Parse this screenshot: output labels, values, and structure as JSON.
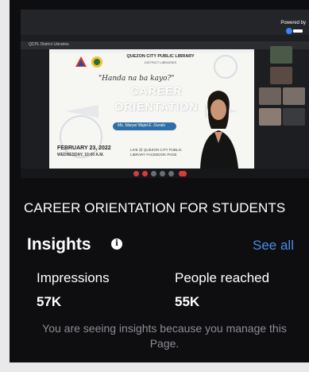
{
  "meeting": {
    "powered_by": "Powered by",
    "bar_text": "QCPL District Libraries",
    "slide": {
      "library_name": "QUEZON CITY PUBLIC LIBRARY",
      "library_sub": "DISTRICT LIBRARIES",
      "tagline": "\"Handa na ba kayo?\"",
      "headline_1": "CAREER",
      "headline_2": "ORIENTATION",
      "speaker_pill": "Ms. Maryel Mejid E. Duralo",
      "date": "FEBRUARY 23, 2022",
      "time": "WEDNESDAY, 10:00 A.M.",
      "venue": "LIVE @ QUEZON CITY PUBLIC LIBRARY FACEBOOK PAGE"
    }
  },
  "post": {
    "title": "CAREER ORIENTATION FOR STUDENTS"
  },
  "insights": {
    "heading": "Insights",
    "info_icon": "info-icon",
    "see_all": "See all",
    "metrics": [
      {
        "label": "Impressions",
        "value": "57K"
      },
      {
        "label": "People reached",
        "value": "55K"
      }
    ],
    "footer_line1": "You are seeing insights because you manage this",
    "footer_line2": "Page."
  },
  "colors": {
    "background": "#0e0e10",
    "link": "#4a8dea",
    "muted": "#8a8d93"
  }
}
